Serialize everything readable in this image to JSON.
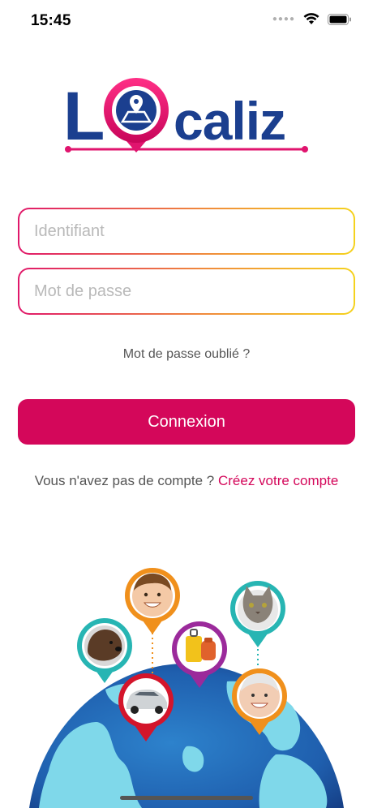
{
  "status_bar": {
    "time": "15:45"
  },
  "logo": {
    "letter_l": "L",
    "rest": "caliz",
    "brand_blue": "#1b3f8f",
    "brand_pink": "#e0146e"
  },
  "login_form": {
    "identifier_placeholder": "Identifiant",
    "password_placeholder": "Mot de passe",
    "forgot_password": "Mot de passe oublié ?",
    "submit_label": "Connexion"
  },
  "signup": {
    "prompt": "Vous n'avez pas de compte ? ",
    "link": "Créez votre compte"
  },
  "illustration": {
    "pins": [
      {
        "subject": "dog-icon",
        "color": "#27b5b3"
      },
      {
        "subject": "child-icon",
        "color": "#f0901c"
      },
      {
        "subject": "luggage-icon",
        "color": "#9b2a9b"
      },
      {
        "subject": "cat-icon",
        "color": "#27b5b3"
      },
      {
        "subject": "car-icon",
        "color": "#d4152b"
      },
      {
        "subject": "grandmother-icon",
        "color": "#f0901c"
      }
    ]
  },
  "colors": {
    "accent": "#d4075a",
    "gradient_start": "#e0186a",
    "gradient_mid": "#f08a3c",
    "gradient_end": "#f5d21e"
  }
}
